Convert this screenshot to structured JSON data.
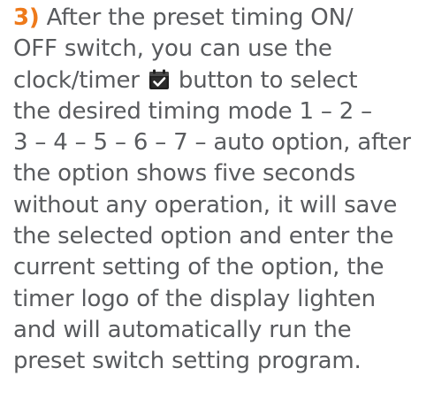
{
  "step": {
    "number": "3)",
    "number_color": "#ee7a1b",
    "text_color": "#595b5e",
    "icon": "clock-timer-icon",
    "lines": [
      " After the preset timing ON/",
      "OFF switch, you can use the",
      "clock/timer",
      " button to select",
      "the desired timing mode 1 – 2 –",
      "3 – 4 – 5 – 6 – 7 – auto option, after",
      "the option shows five seconds",
      "without any operation, it will save",
      "the selected option and enter the",
      "current setting of the option, the",
      "timer logo of the display lighten",
      "and will automatically run the",
      "preset switch setting program."
    ]
  }
}
